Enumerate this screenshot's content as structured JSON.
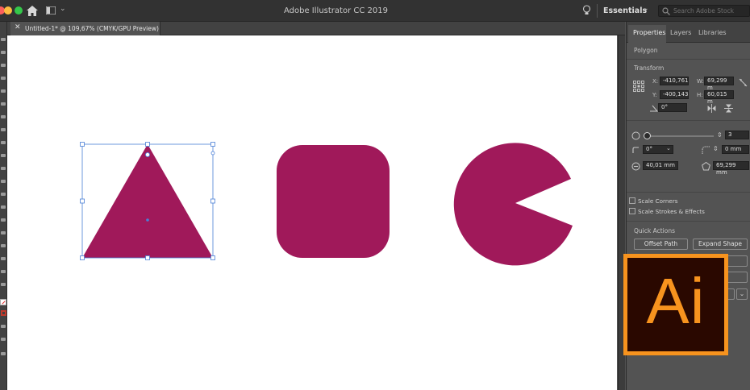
{
  "app": {
    "title": "Adobe Illustrator CC 2019",
    "workspace": "Essentials",
    "search_placeholder": "Search Adobe Stock"
  },
  "document": {
    "tab_label": "Untitled-1* @ 109,67% (CMYK/GPU Preview)"
  },
  "canvas": {
    "artboard_color": "#ffffff",
    "shape_color": "#a0195a",
    "selection_color": "#4a7fd6",
    "shapes": [
      "triangle",
      "rounded-square",
      "pie"
    ]
  },
  "panel": {
    "tabs": [
      "Properties",
      "Layers",
      "Libraries"
    ],
    "active_tab": "Properties",
    "object_type": "Polygon",
    "transform": {
      "label": "Transform",
      "x_label": "X:",
      "x_value": "-410,761",
      "y_label": "Y:",
      "y_value": "-400,143",
      "w_label": "W:",
      "w_value": "69,299 m",
      "h_label": "H:",
      "h_value": "60,015 m",
      "angle": "0°"
    },
    "polygon": {
      "sides": "3",
      "corner_angle": "0°",
      "corner_radius": "0 mm",
      "side_length": "40,01 mm",
      "radius": "69,299 mm"
    },
    "options": {
      "scale_corners": "Scale Corners",
      "scale_strokes": "Scale Strokes & Effects"
    },
    "quick_actions": {
      "label": "Quick Actions",
      "offset_path": "Offset Path",
      "expand_shape": "Expand Shape"
    }
  },
  "logo": {
    "text": "Ai",
    "color": "#f7931e"
  }
}
